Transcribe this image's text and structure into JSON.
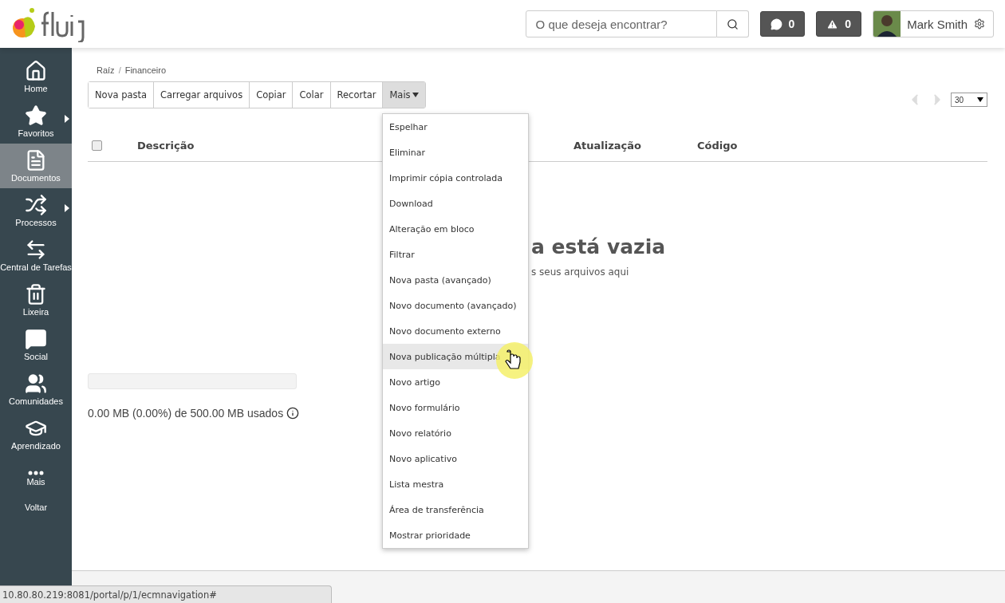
{
  "header": {
    "search": {
      "placeholder": "O que deseja encontrar?"
    },
    "messages": {
      "count": "0"
    },
    "alerts": {
      "count": "0"
    },
    "user": {
      "name": "Mark Smith"
    }
  },
  "sidebar": {
    "items": [
      {
        "label": "Home",
        "selected": false,
        "submenu": false
      },
      {
        "label": "Favoritos",
        "selected": false,
        "submenu": true
      },
      {
        "label": "Documentos",
        "selected": true,
        "submenu": false
      },
      {
        "label": "Processos",
        "selected": false,
        "submenu": true
      },
      {
        "label": "Central de Tarefas",
        "selected": false,
        "submenu": false
      },
      {
        "label": "Lixeira",
        "selected": false,
        "submenu": false
      },
      {
        "label": "Social",
        "selected": false,
        "submenu": false
      },
      {
        "label": "Comunidades",
        "selected": false,
        "submenu": false
      },
      {
        "label": "Aprendizado",
        "selected": false,
        "submenu": false
      },
      {
        "label": "Mais",
        "selected": false,
        "submenu": false
      }
    ],
    "back": "Voltar"
  },
  "breadcrumb": {
    "items": [
      "Raíz",
      "Financeiro"
    ],
    "separator": "/"
  },
  "toolbar": {
    "buttons": [
      "Nova pasta",
      "Carregar arquivos",
      "Copiar",
      "Colar",
      "Recortar"
    ],
    "more": {
      "label": "Mais",
      "expanded": true
    }
  },
  "pager": {
    "page_size": "30"
  },
  "table": {
    "columns": [
      "Descrição",
      "Atualização",
      "Código"
    ],
    "select_all": {
      "checked": false
    }
  },
  "empty": {
    "title": "a está vazia",
    "hint": "s seus arquivos aqui"
  },
  "storage": {
    "level": 0,
    "text": "0.00 MB (0.00%) de 500.00 MB usados"
  },
  "menu": {
    "items": [
      {
        "label": "Espelhar",
        "selected": false
      },
      {
        "label": "Eliminar",
        "selected": false
      },
      {
        "label": "Imprimir cópia controlada",
        "selected": false
      },
      {
        "label": "Download",
        "selected": false
      },
      {
        "label": "Alteração em bloco",
        "selected": false
      },
      {
        "label": "Filtrar",
        "selected": false
      },
      {
        "label": "Nova pasta (avançado)",
        "selected": false
      },
      {
        "label": "Novo documento (avançado)",
        "selected": false
      },
      {
        "label": "Novo documento externo",
        "selected": false
      },
      {
        "label": "Nova publicação múltipla",
        "selected": true
      },
      {
        "label": "Novo artigo",
        "selected": false
      },
      {
        "label": "Novo formulário",
        "selected": false
      },
      {
        "label": "Novo relatório",
        "selected": false
      },
      {
        "label": "Novo aplicativo",
        "selected": false
      },
      {
        "label": "Lista mestra",
        "selected": false
      },
      {
        "label": "Área de transferência",
        "selected": false
      },
      {
        "label": "Mostrar prioridade",
        "selected": false
      }
    ]
  },
  "status_url": "10.80.80.219:8081/portal/p/1/ecmnavigation#"
}
